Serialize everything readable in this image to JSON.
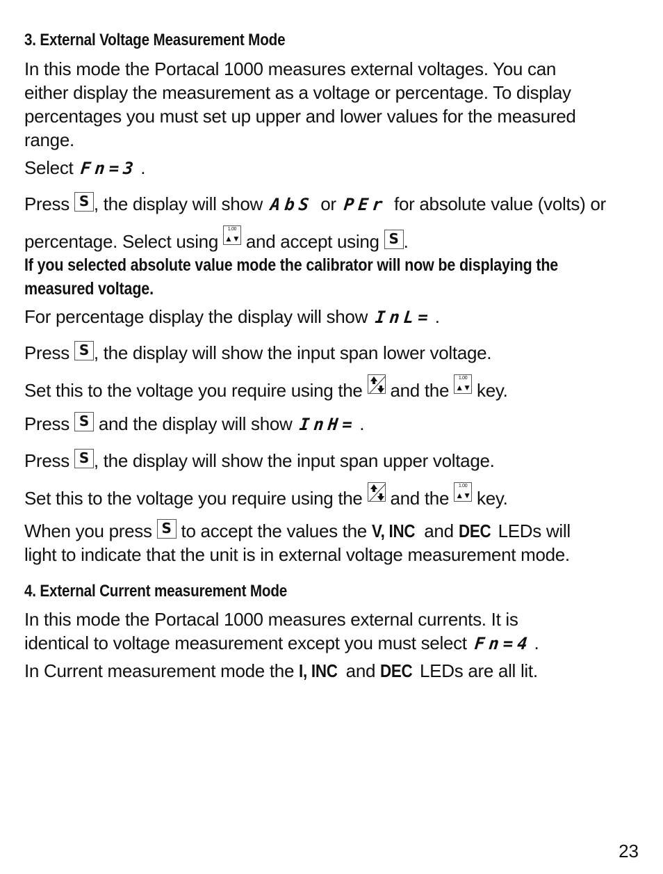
{
  "section3": {
    "heading": "3. External Voltage Measurement Mode",
    "intro_lines": [
      "In this mode the Portacal 1000 measures external voltages. You can",
      "either display the measurement as a voltage or percentage. To display",
      "percentages you must set up upper and lower values for the measured",
      "range."
    ],
    "select_label": "Select",
    "select_code": "Fn=3",
    "press_label": "Press",
    "show_text": ", the display will show",
    "code_abs": "AbS",
    "or": "or",
    "code_per": "PEr",
    "abs_tail": "for absolute value (volts) or",
    "select_line_a": "percentage. Select using",
    "select_line_b": "and accept using",
    "period": ".",
    "bold_lines": [
      "If you selected absolute value mode the calibrator will now be displaying the",
      "measured voltage."
    ],
    "percent_display": "For percentage display the display will show",
    "code_inl": "InL=",
    "lower_span": ", the display will show the input span lower voltage.",
    "set_voltage_a": "Set this to the voltage you require using the",
    "set_voltage_b": "and the",
    "set_voltage_c": "key.",
    "and_display": "and the display will show",
    "code_inh": "InH=",
    "upper_span": ", the display will show the input span upper voltage.",
    "when_press": "When you press",
    "accept_values": "to accept the values the",
    "leds_v_inc": "V, INC",
    "and": "and",
    "leds_dec": "DEC",
    "leds_will": "LEDs will",
    "light_line": "light to indicate that the unit is in external voltage measurement mode."
  },
  "section4": {
    "heading": "4. External Current measurement Mode",
    "line1": "In this mode the Portacal 1000 measures external currents. It is",
    "line2": "identical to voltage measurement except you must select",
    "code": "Fn=4",
    "line3_a": "In Current measurement mode the",
    "leds_i_inc": "I, INC",
    "and": "and",
    "leds_dec": "DEC",
    "line3_b": "LEDs are all lit."
  },
  "keys": {
    "s_key": "S",
    "range_key_label": "1.00",
    "range_key_arrows": "▲▼"
  },
  "page_number": "23"
}
